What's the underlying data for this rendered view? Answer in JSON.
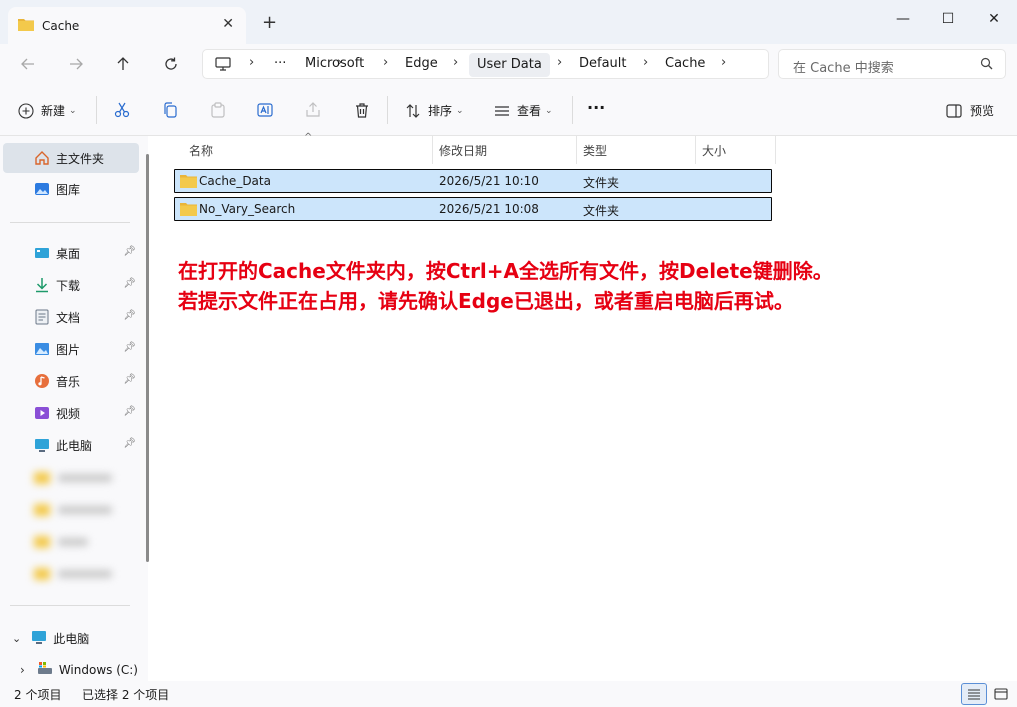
{
  "window": {
    "tab_title": "Cache",
    "new_tab": "+",
    "minimize": "—",
    "maximize": "☐",
    "close": "✕",
    "tab_close": "✕"
  },
  "nav": {
    "breadcrumbs": [
      "Microsoft",
      "Edge",
      "User Data",
      "Default",
      "Cache"
    ],
    "more": "···",
    "search_placeholder": "在 Cache 中搜索"
  },
  "toolbar": {
    "new_label": "新建",
    "sort_label": "排序",
    "view_label": "查看",
    "more": "···",
    "preview_label": "预览"
  },
  "sidebar": {
    "quick": [
      {
        "label": "主文件夹",
        "icon": "home-icon"
      },
      {
        "label": "图库",
        "icon": "gallery-icon"
      }
    ],
    "pinned": [
      {
        "label": "桌面",
        "icon": "desktop-icon"
      },
      {
        "label": "下载",
        "icon": "download-icon"
      },
      {
        "label": "文档",
        "icon": "document-icon"
      },
      {
        "label": "图片",
        "icon": "pictures-icon"
      },
      {
        "label": "音乐",
        "icon": "music-icon"
      },
      {
        "label": "视频",
        "icon": "video-icon"
      },
      {
        "label": "此电脑",
        "icon": "computer-icon"
      }
    ],
    "tree": [
      {
        "label": "此电脑",
        "icon": "computer-icon",
        "expander": "expanded"
      },
      {
        "label": "Windows (C:)",
        "icon": "drive-icon",
        "expander": "collapsed"
      }
    ]
  },
  "columns": [
    "名称",
    "修改日期",
    "类型",
    "大小"
  ],
  "files": [
    {
      "name": "Cache_Data",
      "date": "2026/5/21 10:10",
      "type": "文件夹",
      "size": ""
    },
    {
      "name": "No_Vary_Search",
      "date": "2026/5/21 10:08",
      "type": "文件夹",
      "size": ""
    }
  ],
  "annotation": {
    "line1": "在打开的Cache文件夹内，按Ctrl+A全选所有文件，按Delete键删除。",
    "line2": "若提示文件正在占用，请先确认Edge已退出，或者重启电脑后再试。",
    "color": "#e60012"
  },
  "status": {
    "item_count": "2 个项目",
    "selected_count": "已选择 2 个项目"
  },
  "colors": {
    "accent": "#0a64d8",
    "folder": "#f3c94b",
    "selection": "#cce5fb"
  }
}
